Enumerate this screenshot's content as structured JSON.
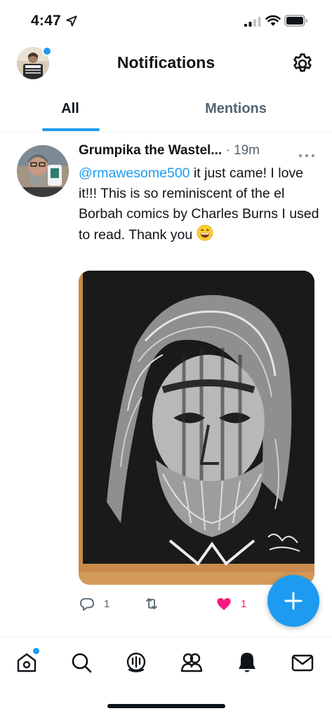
{
  "status_bar": {
    "time": "4:47",
    "icons": [
      "location-arrow-icon",
      "signal-icon",
      "wifi-icon",
      "battery-icon"
    ]
  },
  "header": {
    "title": "Notifications",
    "icons": [
      "avatar",
      "gear-icon"
    ]
  },
  "tabs": [
    {
      "label": "All",
      "selected": true
    },
    {
      "label": "Mentions",
      "selected": false
    }
  ],
  "tweet": {
    "author_name": "Grumpika the Wastel...",
    "separator": "·",
    "time": "19m",
    "mention": "@rmawesome500",
    "text_line1": " it just came!",
    "text_rest": "I love it!!! This is so reminiscent of the el Borbah comics by Charles Burns I used to read. Thank you",
    "emoji": "grinning-face-emoji",
    "media": "scratchboard-portrait-artwork",
    "actions": {
      "reply_count": "1",
      "retweet_count": "",
      "like_count": "1"
    }
  },
  "bottom_nav": {
    "items": [
      "home-icon",
      "search-icon",
      "spaces-icon",
      "communities-icon",
      "bell-icon",
      "mail-icon"
    ]
  },
  "colors": {
    "accent": "#1d9bf0",
    "like": "#f91880",
    "secondary_text": "#536471"
  }
}
